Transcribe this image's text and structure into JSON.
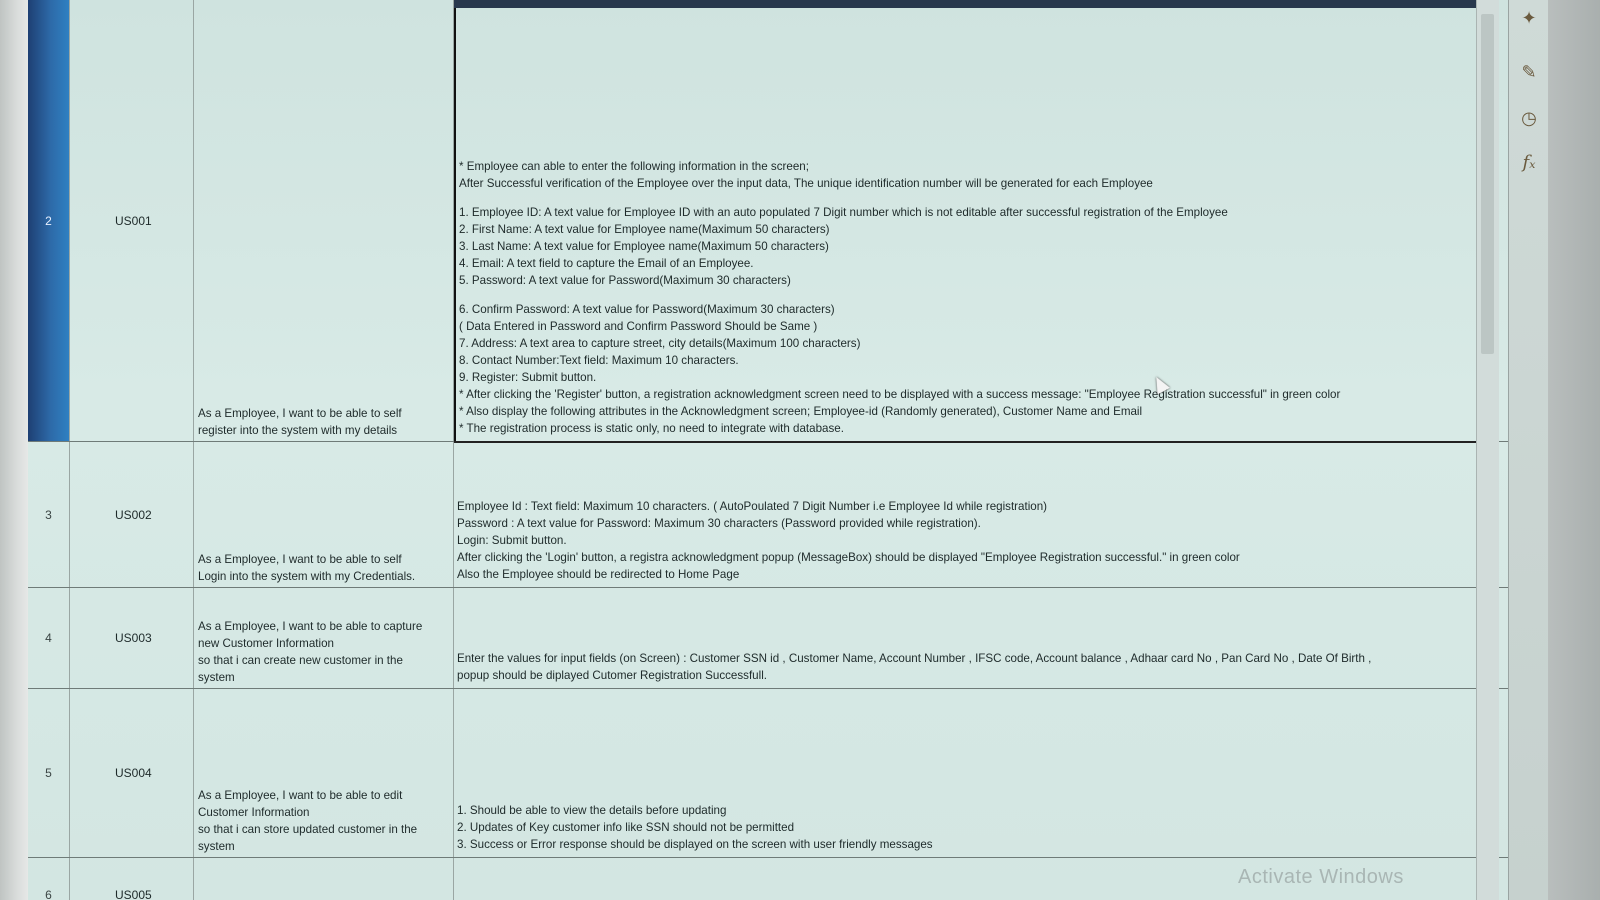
{
  "rows": [
    {
      "num": "2",
      "id": "US001",
      "story": [
        "As a Employee, I want to be able to self",
        "register into the system with my details"
      ],
      "desc": [
        "* Employee can able to enter the following information in the screen;",
        "After Successful verification of the Employee over the input data, The unique identification number will be generated for each Employee",
        "",
        "1. Employee ID: A text value for Employee ID with an auto populated 7 Digit number which is not editable after successful registration of the Employee",
        "2. First Name: A text value for Employee name(Maximum 50 characters)",
        "3. Last Name: A text value for Employee name(Maximum 50 characters)",
        "4. Email: A text field to capture the Email of an Employee.",
        "5. Password: A text value for Password(Maximum 30 characters)",
        "",
        "6. Confirm Password: A text value for Password(Maximum 30 characters)",
        "( Data Entered in Password and Confirm Password Should be Same )",
        "7. Address: A text area to capture street, city details(Maximum 100 characters)",
        "8. Contact Number:Text field: Maximum 10 characters.",
        "9. Register: Submit button.",
        "* After clicking the 'Register' button, a registration acknowledgment screen need to be displayed with a success message: \"Employee Registration successful\" in green color",
        "* Also display the following attributes in the Acknowledgment screen; Employee-id (Randomly generated), Customer Name and Email",
        "* The registration process is static only, no need to integrate with database."
      ]
    },
    {
      "num": "3",
      "id": "US002",
      "story": [
        "As a Employee, I want to be able to self",
        "Login into the system with my Credentials."
      ],
      "desc": [
        "Employee Id : Text field: Maximum 10 characters. ( AutoPoulated 7 Digit Number i.e Employee Id while registration)",
        "Password : A text value for Password: Maximum 30 characters (Password provided while registration).",
        "Login: Submit button.",
        "After clicking the 'Login' button, a registra acknowledgment popup (MessageBox) should be displayed \"Employee Registration successful.\" in green color",
        "Also the Employee should be redirected to Home Page"
      ]
    },
    {
      "num": "4",
      "id": "US003",
      "story": [
        "As a Employee, I want to be able to capture",
        "new Customer Information",
        "so that i can create new customer in the",
        "system"
      ],
      "desc": [
        "Enter the values for input fields (on Screen) : Customer SSN id , Customer Name, Account Number , IFSC code, Account balance , Adhaar card No , Pan Card No , Date Of Birth ,",
        "popup should be diplayed Cutomer Registration Successfull."
      ]
    },
    {
      "num": "5",
      "id": "US004",
      "story": [
        "As a Employee, I want to be able to edit",
        "Customer Information",
        "so that i can store updated customer in the",
        "system"
      ],
      "desc": [
        "1. Should be able to view the details before updating",
        "2. Updates of Key customer info like SSN should not be permitted",
        "3. Success or Error response should be displayed on the screen with user friendly messages"
      ]
    },
    {
      "num": "6",
      "id": "US005",
      "story": [],
      "desc": []
    }
  ],
  "watermark": "Activate Windows",
  "panel_icons": [
    "insert-icon",
    "comment-icon",
    "clock-icon",
    "function-icon"
  ]
}
